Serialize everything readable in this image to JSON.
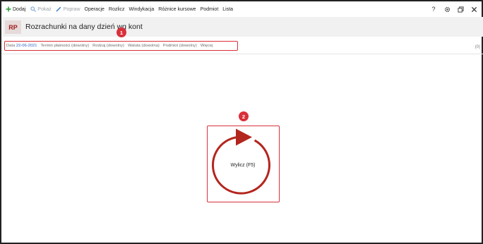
{
  "toolbar": {
    "items": [
      {
        "label": "Dodaj",
        "icon": "plus-icon",
        "enabled": true
      },
      {
        "label": "Pokaż",
        "icon": "magnifier-icon",
        "enabled": false
      },
      {
        "label": "Popraw",
        "icon": "pencil-icon",
        "enabled": false
      },
      {
        "label": "Operacje",
        "enabled": true
      },
      {
        "label": "Rozlicz",
        "enabled": true
      },
      {
        "label": "Windykacja",
        "enabled": true
      },
      {
        "label": "Różnice kursowe",
        "enabled": true
      },
      {
        "label": "Podmiot",
        "enabled": true
      },
      {
        "label": "Lista",
        "enabled": true
      }
    ],
    "right": {
      "help": "?",
      "icons": [
        "gear-icon",
        "window-restore-icon",
        "close-icon"
      ]
    }
  },
  "header": {
    "badge": "RP",
    "title": "Rozrachunki na dany dzień wg kont"
  },
  "filters": {
    "date_label": "Data",
    "date_value": "22-06-2021",
    "items": [
      "Termin płatności (dowolny)",
      "Rodzaj (dowolny)",
      "Waluta (dowolna)",
      "Podmiot (dowolny)",
      "Więcej"
    ],
    "count": "(0)"
  },
  "callouts": [
    "1",
    "2"
  ],
  "calc": {
    "label": "Wylicz (F5)",
    "icon": "refresh-play-icon"
  },
  "colors": {
    "accent_red": "#d9303a",
    "dark_red": "#b3261e",
    "link_blue": "#2b63c4",
    "plus_green": "#2e9e3e"
  }
}
